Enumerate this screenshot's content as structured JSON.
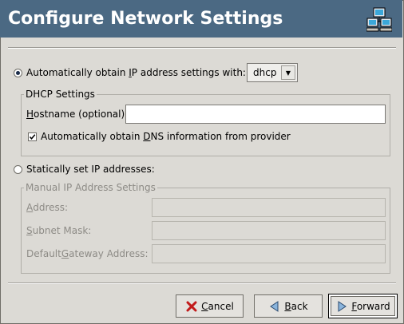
{
  "window": {
    "title": "Configure Network Settings",
    "icon": "network-icon"
  },
  "auto": {
    "label_pre": "Automatically obtain ",
    "label_u": "I",
    "label_post": "P address settings with:",
    "selected": true,
    "method": "dhcp"
  },
  "dhcp": {
    "group_label": "DHCP Settings",
    "hostname_u": "H",
    "hostname_rest": "ostname (optional):",
    "hostname_value": "",
    "dns_pre": "Automatically obtain ",
    "dns_u": "D",
    "dns_post": "NS information from provider",
    "dns_checked": true
  },
  "static": {
    "label": "Statically set IP addresses:",
    "selected": false
  },
  "manual": {
    "group_label": "Manual IP Address Settings",
    "address_u": "A",
    "address_rest": "ddress:",
    "subnet_u": "S",
    "subnet_rest": "ubnet Mask:",
    "gateway_pre": "Default ",
    "gateway_u": "G",
    "gateway_post": "ateway Address:"
  },
  "buttons": {
    "cancel_u": "C",
    "cancel_rest": "ancel",
    "back_u": "B",
    "back_rest": "ack",
    "forward_u": "F",
    "forward_rest": "orward"
  },
  "colors": {
    "header": "#4b6983",
    "background": "#dcdad5"
  }
}
